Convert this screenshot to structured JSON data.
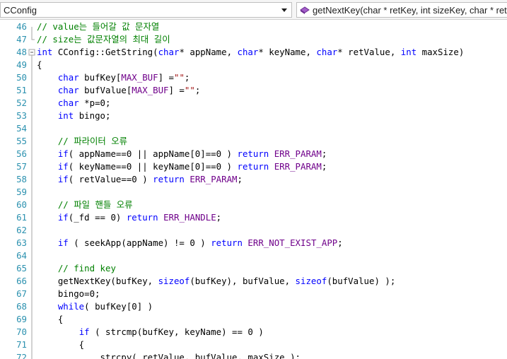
{
  "toolbar": {
    "class_dropdown": {
      "value": "CConfig"
    },
    "member_dropdown": {
      "value": "getNextKey(char * retKey, int sizeKey, char * retValue"
    }
  },
  "editor": {
    "lines": [
      {
        "num": "46",
        "tokens": [
          {
            "t": "// value는 들어갈 값 문자열",
            "c": "cm"
          }
        ]
      },
      {
        "num": "47",
        "tokens": [
          {
            "t": "// size는 값문자열의 최대 길이",
            "c": "cm"
          }
        ]
      },
      {
        "num": "48",
        "tokens": [
          {
            "t": "int",
            "c": "kw"
          },
          {
            "t": " CConfig::GetString(",
            "c": ""
          },
          {
            "t": "char",
            "c": "kw"
          },
          {
            "t": "* appName, ",
            "c": ""
          },
          {
            "t": "char",
            "c": "kw"
          },
          {
            "t": "* keyName, ",
            "c": ""
          },
          {
            "t": "char",
            "c": "kw"
          },
          {
            "t": "* retValue, ",
            "c": ""
          },
          {
            "t": "int",
            "c": "kw"
          },
          {
            "t": " maxSize)",
            "c": ""
          }
        ]
      },
      {
        "num": "49",
        "tokens": [
          {
            "t": "{",
            "c": ""
          }
        ]
      },
      {
        "num": "50",
        "tokens": [
          {
            "t": "    ",
            "c": ""
          },
          {
            "t": "char",
            "c": "kw"
          },
          {
            "t": " bufKey[",
            "c": ""
          },
          {
            "t": "MAX_BUF",
            "c": "mac"
          },
          {
            "t": "] =",
            "c": ""
          },
          {
            "t": "\"\"",
            "c": "st"
          },
          {
            "t": ";",
            "c": ""
          }
        ]
      },
      {
        "num": "51",
        "tokens": [
          {
            "t": "    ",
            "c": ""
          },
          {
            "t": "char",
            "c": "kw"
          },
          {
            "t": " bufValue[",
            "c": ""
          },
          {
            "t": "MAX_BUF",
            "c": "mac"
          },
          {
            "t": "] =",
            "c": ""
          },
          {
            "t": "\"\"",
            "c": "st"
          },
          {
            "t": ";",
            "c": ""
          }
        ]
      },
      {
        "num": "52",
        "tokens": [
          {
            "t": "    ",
            "c": ""
          },
          {
            "t": "char",
            "c": "kw"
          },
          {
            "t": " *p=0;",
            "c": ""
          }
        ]
      },
      {
        "num": "53",
        "tokens": [
          {
            "t": "    ",
            "c": ""
          },
          {
            "t": "int",
            "c": "kw"
          },
          {
            "t": " bingo;",
            "c": ""
          }
        ]
      },
      {
        "num": "54",
        "tokens": []
      },
      {
        "num": "55",
        "tokens": [
          {
            "t": "    ",
            "c": ""
          },
          {
            "t": "// 파라이터 오류",
            "c": "cm"
          }
        ]
      },
      {
        "num": "56",
        "tokens": [
          {
            "t": "    ",
            "c": ""
          },
          {
            "t": "if",
            "c": "kw"
          },
          {
            "t": "( appName==0 || appName[0]==0 ) ",
            "c": ""
          },
          {
            "t": "return",
            "c": "kw"
          },
          {
            "t": " ",
            "c": ""
          },
          {
            "t": "ERR_PARAM",
            "c": "mac"
          },
          {
            "t": ";",
            "c": ""
          }
        ]
      },
      {
        "num": "57",
        "tokens": [
          {
            "t": "    ",
            "c": ""
          },
          {
            "t": "if",
            "c": "kw"
          },
          {
            "t": "( keyName==0 || keyName[0]==0 ) ",
            "c": ""
          },
          {
            "t": "return",
            "c": "kw"
          },
          {
            "t": " ",
            "c": ""
          },
          {
            "t": "ERR_PARAM",
            "c": "mac"
          },
          {
            "t": ";",
            "c": ""
          }
        ]
      },
      {
        "num": "58",
        "tokens": [
          {
            "t": "    ",
            "c": ""
          },
          {
            "t": "if",
            "c": "kw"
          },
          {
            "t": "( retValue==0 ) ",
            "c": ""
          },
          {
            "t": "return",
            "c": "kw"
          },
          {
            "t": " ",
            "c": ""
          },
          {
            "t": "ERR_PARAM",
            "c": "mac"
          },
          {
            "t": ";",
            "c": ""
          }
        ]
      },
      {
        "num": "59",
        "tokens": []
      },
      {
        "num": "60",
        "tokens": [
          {
            "t": "    ",
            "c": ""
          },
          {
            "t": "// 파일 핸들 오류",
            "c": "cm"
          }
        ]
      },
      {
        "num": "61",
        "tokens": [
          {
            "t": "    ",
            "c": ""
          },
          {
            "t": "if",
            "c": "kw"
          },
          {
            "t": "(_fd == 0) ",
            "c": ""
          },
          {
            "t": "return",
            "c": "kw"
          },
          {
            "t": " ",
            "c": ""
          },
          {
            "t": "ERR_HANDLE",
            "c": "mac"
          },
          {
            "t": ";",
            "c": ""
          }
        ]
      },
      {
        "num": "62",
        "tokens": []
      },
      {
        "num": "63",
        "tokens": [
          {
            "t": "    ",
            "c": ""
          },
          {
            "t": "if",
            "c": "kw"
          },
          {
            "t": " ( seekApp(appName) != 0 ) ",
            "c": ""
          },
          {
            "t": "return",
            "c": "kw"
          },
          {
            "t": " ",
            "c": ""
          },
          {
            "t": "ERR_NOT_EXIST_APP",
            "c": "mac"
          },
          {
            "t": ";",
            "c": ""
          }
        ]
      },
      {
        "num": "64",
        "tokens": []
      },
      {
        "num": "65",
        "tokens": [
          {
            "t": "    ",
            "c": ""
          },
          {
            "t": "// find key",
            "c": "cm"
          }
        ]
      },
      {
        "num": "66",
        "tokens": [
          {
            "t": "    getNextKey(bufKey, ",
            "c": ""
          },
          {
            "t": "sizeof",
            "c": "kw"
          },
          {
            "t": "(bufKey), bufValue, ",
            "c": ""
          },
          {
            "t": "sizeof",
            "c": "kw"
          },
          {
            "t": "(bufValue) );",
            "c": ""
          }
        ]
      },
      {
        "num": "67",
        "tokens": [
          {
            "t": "    bingo=0;",
            "c": ""
          }
        ]
      },
      {
        "num": "68",
        "tokens": [
          {
            "t": "    ",
            "c": ""
          },
          {
            "t": "while",
            "c": "kw"
          },
          {
            "t": "( bufKey[0] )",
            "c": ""
          }
        ]
      },
      {
        "num": "69",
        "tokens": [
          {
            "t": "    {",
            "c": ""
          }
        ]
      },
      {
        "num": "70",
        "tokens": [
          {
            "t": "        ",
            "c": ""
          },
          {
            "t": "if",
            "c": "kw"
          },
          {
            "t": " ( strcmp(bufKey, keyName) == 0 )",
            "c": ""
          }
        ]
      },
      {
        "num": "71",
        "tokens": [
          {
            "t": "        {",
            "c": ""
          }
        ]
      },
      {
        "num": "72",
        "tokens": [
          {
            "t": "            strcpy( retValue, bufValue, maxSize );",
            "c": ""
          }
        ]
      }
    ]
  }
}
